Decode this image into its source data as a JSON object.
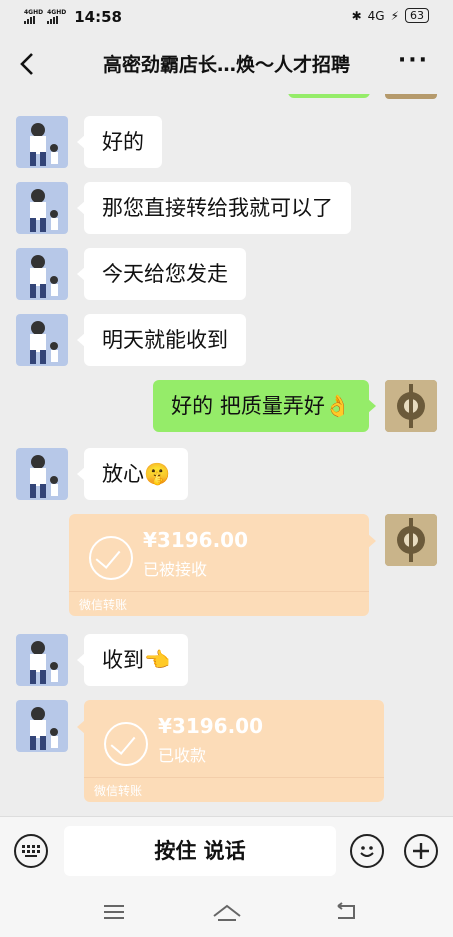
{
  "status_bar": {
    "net1": "4GHD",
    "net2": "4GHD",
    "time": "14:58",
    "net3": "4G",
    "battery": "63"
  },
  "header": {
    "title": "高密劲霸店长…焕〜人才招聘"
  },
  "messages": [
    {
      "sender": "other",
      "text": "好的"
    },
    {
      "sender": "other",
      "text": "那您直接转给我就可以了"
    },
    {
      "sender": "other",
      "text": "今天给您发走"
    },
    {
      "sender": "other",
      "text": "明天就能收到"
    },
    {
      "sender": "me",
      "text": "好的  把质量弄好👌"
    },
    {
      "sender": "other",
      "text": "放心🤫"
    },
    {
      "sender": "me",
      "type": "transfer",
      "amount": "¥3196.00",
      "status": "已被接收",
      "footer": "微信转账"
    },
    {
      "sender": "other",
      "text": "收到👈"
    },
    {
      "sender": "other",
      "type": "transfer",
      "amount": "¥3196.00",
      "status": "已收款",
      "footer": "微信转账"
    }
  ],
  "input_bar": {
    "hold_label": "按住 说话"
  }
}
